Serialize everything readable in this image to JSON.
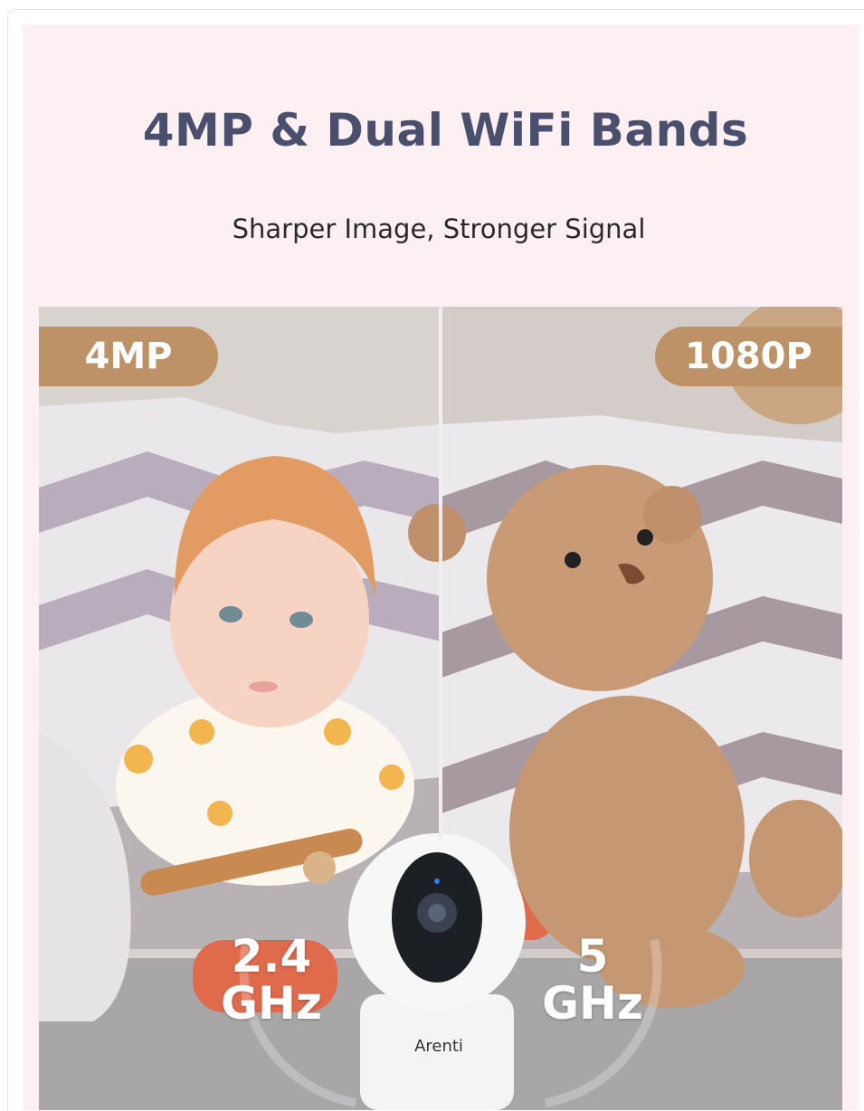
{
  "header": {
    "title": "4MP & Dual WiFi Bands",
    "subtitle": "Sharper Image, Stronger Signal"
  },
  "comparison": {
    "left_badge": "4MP",
    "right_badge": "1080P"
  },
  "bands": {
    "left_value": "2.4",
    "left_unit": "GHz",
    "right_value": "5",
    "right_unit": "GHz"
  },
  "camera": {
    "brand": "Arenti"
  },
  "colors": {
    "background": "#fdf0f2",
    "title": "#4a4f6e",
    "badge": "#bd9267"
  }
}
